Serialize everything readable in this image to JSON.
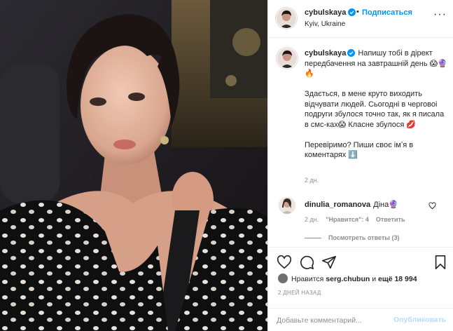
{
  "post": {
    "username": "cybulskaya",
    "verified": true,
    "follow_label": "Подписаться",
    "separator": "•",
    "location": "Kyiv, Ukraine",
    "more_icon": "more-options-icon",
    "photo_description_icon": "post-photo"
  },
  "caption": {
    "username": "cybulskaya",
    "text": "Напишу тобі в дірект передбачення на завтрашній день 😱🔮🔥\n\nЗдається, в мене круто виходить відчувати людей. Сьогодні в черговоі подруги збулося точно так, як я писала в смс-ках😱 Класне збулося 💋\n\nПеревіримо? Пиши своє імʼя в коментарях ⬇️",
    "time": "2 дн."
  },
  "comments": [
    {
      "username": "dinulia_romanova",
      "text": "Діна🔮",
      "time": "2 дн.",
      "likes_label": "\"Нравится\": 4",
      "reply_label": "Ответить"
    }
  ],
  "replies_label": "Посмотреть ответы (3)",
  "actions": {
    "like_icon": "heart-icon",
    "comment_icon": "comment-icon",
    "share_icon": "share-icon",
    "save_icon": "bookmark-icon"
  },
  "likes": {
    "prefix": "Нравится",
    "user": "serg.chubun",
    "middle": "и",
    "others": "ещё 18 994"
  },
  "post_date": "2 ДНЕЙ НАЗАД",
  "add_comment": {
    "placeholder": "Добавьте комментарий...",
    "publish_label": "Опубликовать"
  },
  "colors": {
    "accent": "#0095f6",
    "publish_disabled": "#b2dffc",
    "secondary_text": "#8e8e8e",
    "border": "#efefef"
  }
}
